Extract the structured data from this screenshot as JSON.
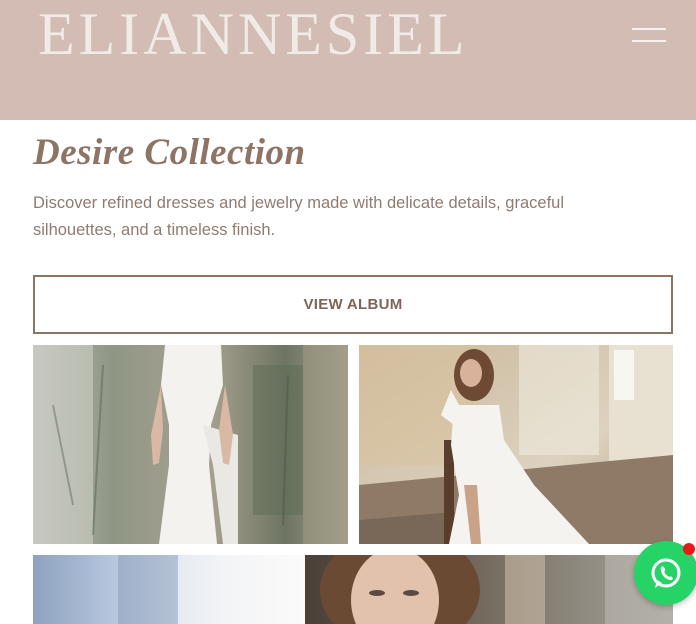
{
  "header": {
    "logo_text": "ELIANNESIEL",
    "menu_icon": "hamburger-menu-icon",
    "background_color": "#d3bcb4"
  },
  "collection": {
    "title": "Desire Collection",
    "description": "Discover refined dresses and jewelry made with delicate details, graceful silhouettes, and a timeless finish.",
    "view_album_label": "VIEW ALBUM"
  },
  "gallery": {
    "images": [
      {
        "subject": "bride-in-strapless-white-gown-against-painted-wall"
      },
      {
        "subject": "bride-seated-on-chair-in-off-shoulder-gown"
      },
      {
        "subject": "blurred-blue-background"
      },
      {
        "subject": "bride-portrait-close-up"
      }
    ]
  },
  "chat_widget": {
    "icon": "whatsapp-icon",
    "color": "#25d366",
    "notification_color": "#e8191a"
  }
}
